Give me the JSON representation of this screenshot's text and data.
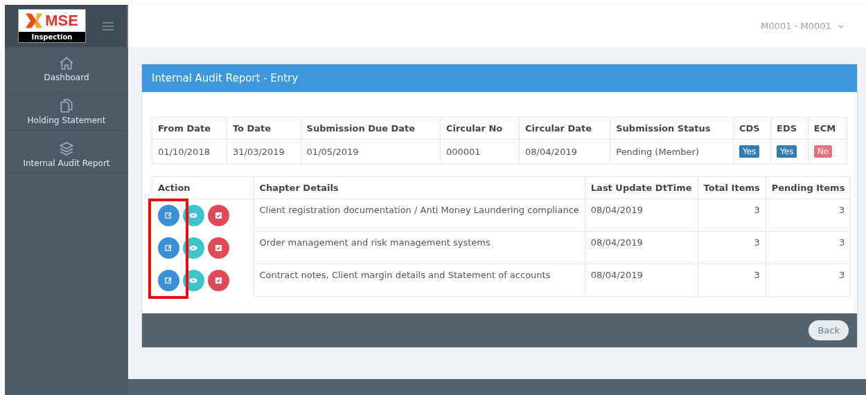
{
  "brand": {
    "logo": "MSE",
    "subtitle": "Inspection"
  },
  "user": {
    "label": "M0001 - M0001"
  },
  "sidebar": {
    "items": [
      {
        "label": "Dashboard"
      },
      {
        "label": "Holding Statement"
      },
      {
        "label": "Internal Audit Report"
      }
    ]
  },
  "panel": {
    "title": "Internal Audit Report - Entry",
    "summary": {
      "columns": [
        "From Date",
        "To Date",
        "Submission Due Date",
        "Circular No",
        "Circular Date",
        "Submission Status",
        "CDS",
        "EDS",
        "ECM"
      ],
      "row": [
        "01/10/2018",
        "31/03/2019",
        "01/05/2019",
        "000001",
        "08/04/2019",
        "Pending (Member)"
      ],
      "flags": [
        {
          "label": "Yes",
          "color": "#337ab7"
        },
        {
          "label": "Yes",
          "color": "#337ab7"
        },
        {
          "label": "No",
          "color": "#e8707a"
        }
      ]
    },
    "chapters": {
      "columns": [
        "Action",
        "Chapter Details",
        "Last Update DtTime",
        "Total Items",
        "Pending Items"
      ],
      "rows": [
        {
          "details": "Client registration documentation / Anti Money Laundering compliance",
          "updated": "08/04/2019",
          "total": "3",
          "pending": "3"
        },
        {
          "details": "Order management and risk management systems",
          "updated": "08/04/2019",
          "total": "3",
          "pending": "3"
        },
        {
          "details": "Contract notes, Client margin details and Statement of accounts",
          "updated": "08/04/2019",
          "total": "3",
          "pending": "3"
        }
      ]
    },
    "back": "Back"
  }
}
